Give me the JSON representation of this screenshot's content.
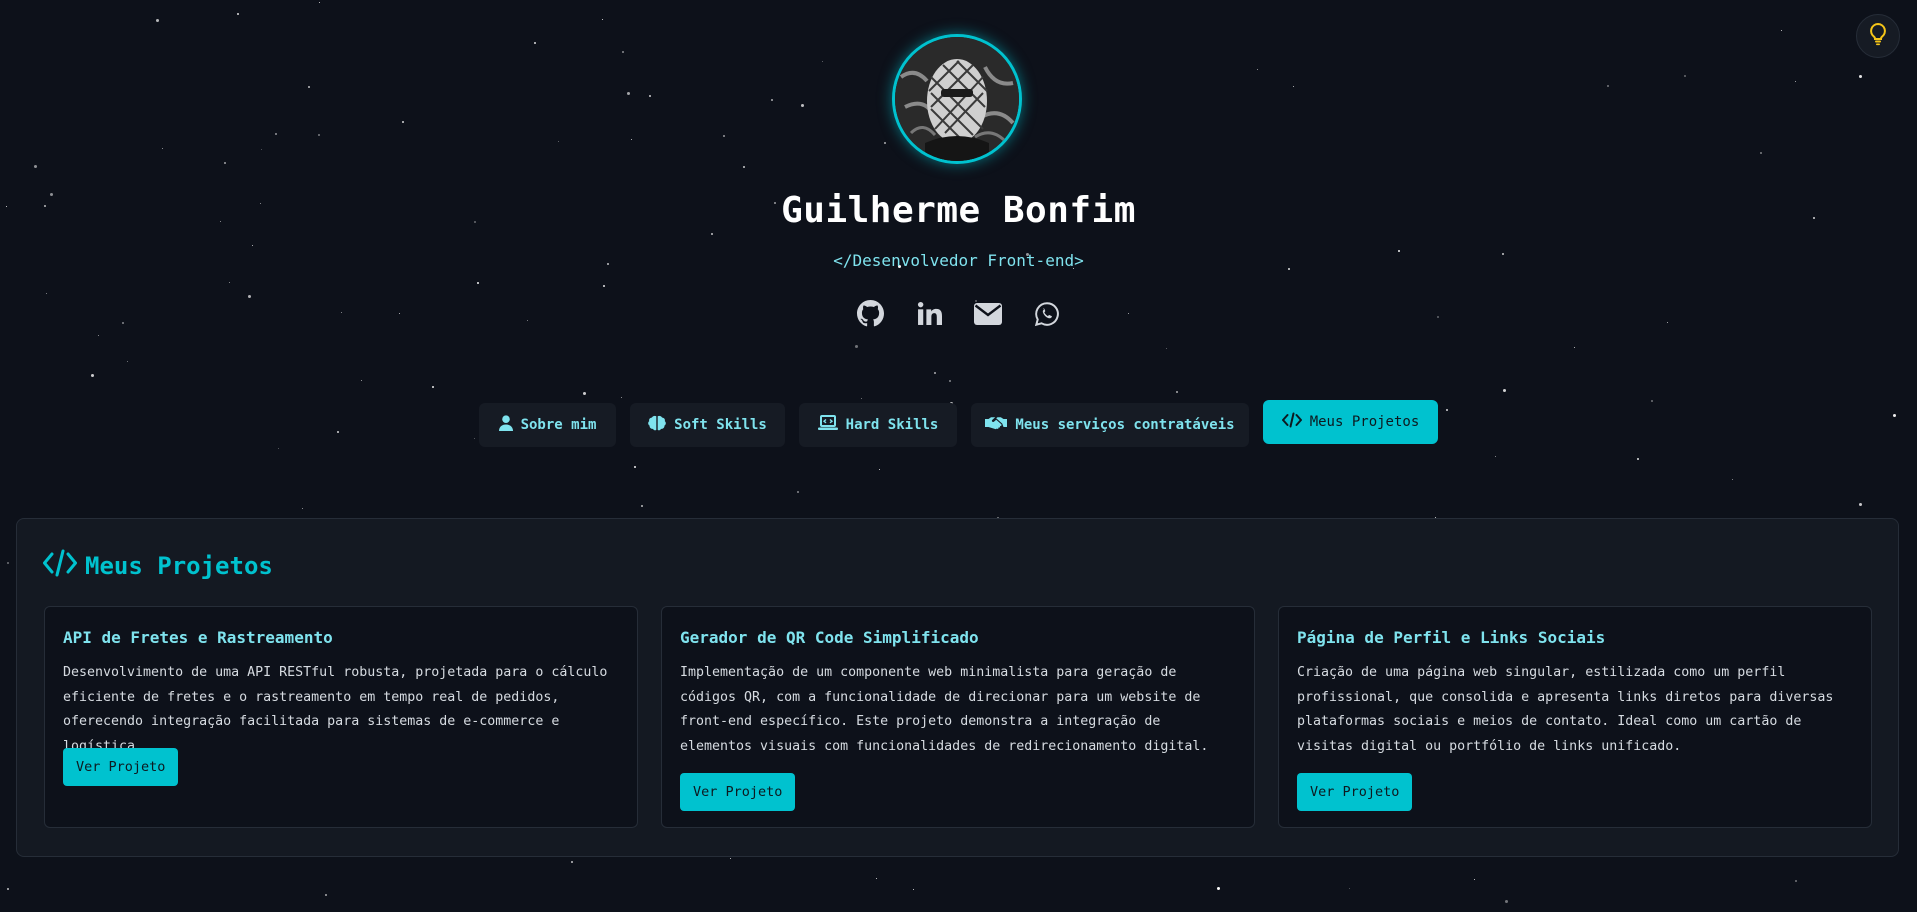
{
  "profile": {
    "name": "Guilherme Bonfim",
    "subtitle": "</Desenvolvedor Front-end>"
  },
  "socials": [
    {
      "icon": "github-icon"
    },
    {
      "icon": "linkedin-icon"
    },
    {
      "icon": "email-icon"
    },
    {
      "icon": "whatsapp-icon"
    }
  ],
  "tabs": [
    {
      "label": "Sobre mim",
      "icon": "user-icon",
      "active": false
    },
    {
      "label": "Soft Skills",
      "icon": "brain-icon",
      "active": false
    },
    {
      "label": "Hard Skills",
      "icon": "laptop-code-icon",
      "active": false
    },
    {
      "label": "Meus serviços contratáveis",
      "icon": "handshake-icon",
      "active": false
    },
    {
      "label": "Meus Projetos",
      "icon": "code-icon",
      "active": true
    }
  ],
  "projects_section": {
    "title": "Meus Projetos",
    "cards": [
      {
        "title": "API de Fretes e Rastreamento",
        "description": "Desenvolvimento de uma API RESTful robusta, projetada para o cálculo eficiente de fretes e o rastreamento em tempo real de pedidos, oferecendo integração facilitada para sistemas de e-commerce e logística.",
        "button": "Ver Projeto"
      },
      {
        "title": "Gerador de QR Code Simplificado",
        "description": "Implementação de um componente web minimalista para geração de códigos QR, com a funcionalidade de direcionar para um website de front-end específico. Este projeto demonstra a integração de elementos visuais com funcionalidades de redirecionamento digital.",
        "button": "Ver Projeto"
      },
      {
        "title": "Página de Perfil e Links Sociais",
        "description": "Criação de uma página web singular, estilizada como um perfil profissional, que consolida e apresenta links diretos para diversas plataformas sociais e meios de contato. Ideal como um cartão de visitas digital ou portfólio de links unificado.",
        "button": "Ver Projeto"
      }
    ]
  },
  "colors": {
    "background": "#0d111a",
    "accent": "#00c2cf",
    "accent_text": "#7fe3ee",
    "panel": "#141922",
    "bulb": "#f5c518"
  }
}
